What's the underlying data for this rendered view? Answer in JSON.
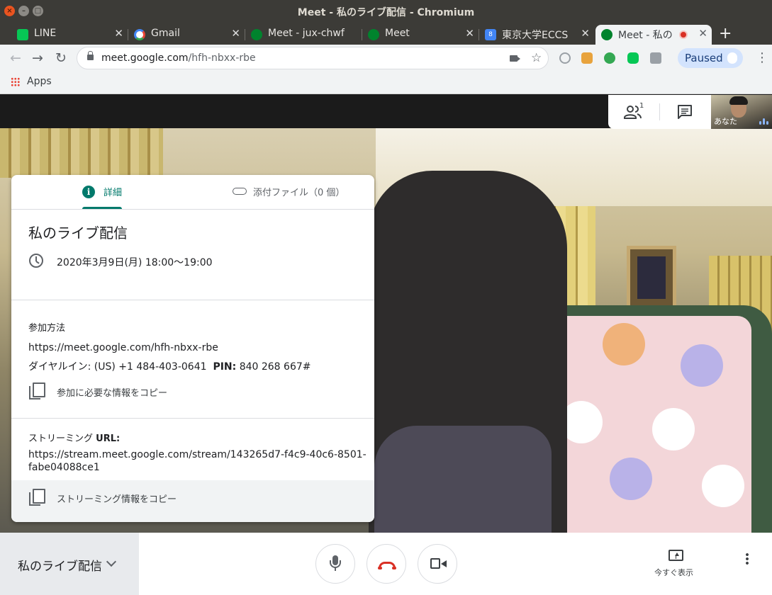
{
  "window": {
    "title": "Meet - 私のライブ配信 - Chromium"
  },
  "tabs": [
    {
      "label": "LINE",
      "icon": "line-icon",
      "color": "#06c755"
    },
    {
      "label": "Gmail",
      "icon": "google-icon",
      "color": "#4285f4"
    },
    {
      "label": "Meet - jux-chwf",
      "icon": "meet-icon",
      "color": "#00832d"
    },
    {
      "label": "Meet",
      "icon": "meet-icon",
      "color": "#00832d"
    },
    {
      "label": "東京大学ECCS",
      "icon": "calendar-icon",
      "color": "#4285f4"
    },
    {
      "label": "Meet - 私の",
      "icon": "meet-icon",
      "color": "#00832d",
      "active": true
    }
  ],
  "address_bar": {
    "host": "meet.google.com",
    "path": "/hfh-nbxx-rbe"
  },
  "profile": {
    "label": "Paused"
  },
  "bookmarks": {
    "apps_label": "Apps"
  },
  "meet": {
    "participants_count": "1",
    "self_label": "あなた",
    "panel": {
      "tab_details": "詳細",
      "tab_attachments": "添付ファイル（0 個）",
      "title": "私のライブ配信",
      "datetime": "2020年3月9日(月) 18:00～19:00",
      "join_heading": "参加方法",
      "join_url": "https://meet.google.com/hfh-nbxx-rbe",
      "dialin_label": "ダイヤルイン:",
      "dialin_number": "(US) +1 484-403-0641",
      "pin_label": "PIN:",
      "pin_value": "840 268 667#",
      "copy_join": "参加に必要な情報をコピー",
      "streaming_heading_prefix": "ストリーミング",
      "streaming_heading_suffix": "URL:",
      "streaming_url_line1": "https://stream.meet.google.com/stream/143265d7-f4c9-40c6-8501-",
      "streaming_url_line2": "fabe04088ce1",
      "copy_streaming": "ストリーミング情報をコピー"
    },
    "bottom": {
      "meeting_name": "私のライブ配信",
      "present_label": "今すぐ表示"
    },
    "colors": {
      "accent": "#00796b",
      "hangup": "#d93025"
    }
  }
}
